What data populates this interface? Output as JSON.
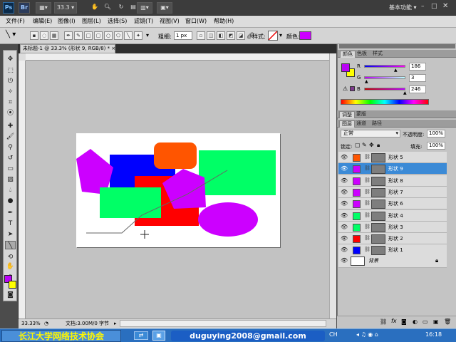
{
  "appbar": {
    "logo": "Ps",
    "br": "Br",
    "zoom": "33.3",
    "workspace": "基本功能"
  },
  "menu": [
    "文件(F)",
    "编辑(E)",
    "图像(I)",
    "图层(L)",
    "选择(S)",
    "滤镜(T)",
    "视图(V)",
    "窗口(W)",
    "帮助(H)"
  ],
  "options": {
    "weight_label": "粗细:",
    "weight_value": "1 px",
    "style_label": "样式:",
    "color_label": "颜色:",
    "color_value": "#cc00ff"
  },
  "document": {
    "tab_title": "未标题-1 @ 33.3% (形状 9, RGB/8) *",
    "tab_close": "×"
  },
  "status": {
    "zoom": "33.33%",
    "doc_info": "文档:3.00M/0 字节"
  },
  "color_panel": {
    "tabs": [
      "颜色",
      "色板",
      "样式"
    ],
    "r_label": "R",
    "g_label": "G",
    "b_label": "B",
    "r": "186",
    "g": "3",
    "b": "246",
    "fg_color": "#ba03f6",
    "bg_color": "#ffff00"
  },
  "adjust_panel": {
    "tabs": [
      "调整",
      "蒙版"
    ]
  },
  "layers_panel": {
    "tabs": [
      "图层",
      "通道",
      "路径"
    ],
    "blend_mode": "正常",
    "opacity_label": "不透明度:",
    "opacity": "100%",
    "lock_label": "锁定:",
    "fill_label": "填充:",
    "fill": "100%",
    "layers": [
      {
        "name": "形状 5",
        "color": "#ff5500",
        "selected": false
      },
      {
        "name": "形状 9",
        "color": "#cc00ff",
        "selected": true
      },
      {
        "name": "形状 8",
        "color": "#cc00ff",
        "selected": false
      },
      {
        "name": "形状 7",
        "color": "#cc00ff",
        "selected": false
      },
      {
        "name": "形状 6",
        "color": "#cc00ff",
        "selected": false
      },
      {
        "name": "形状 4",
        "color": "#00ff66",
        "selected": false
      },
      {
        "name": "形状 3",
        "color": "#00ff66",
        "selected": false
      },
      {
        "name": "形状 2",
        "color": "#ff0000",
        "selected": false
      },
      {
        "name": "形状 1",
        "color": "#0000ff",
        "selected": false
      }
    ],
    "background_name": "背景"
  },
  "taskbar": {
    "banner": "长江大学网络技术协会",
    "email": "duguying2008@gmail.com",
    "time": "16:18",
    "lang": "CH"
  }
}
